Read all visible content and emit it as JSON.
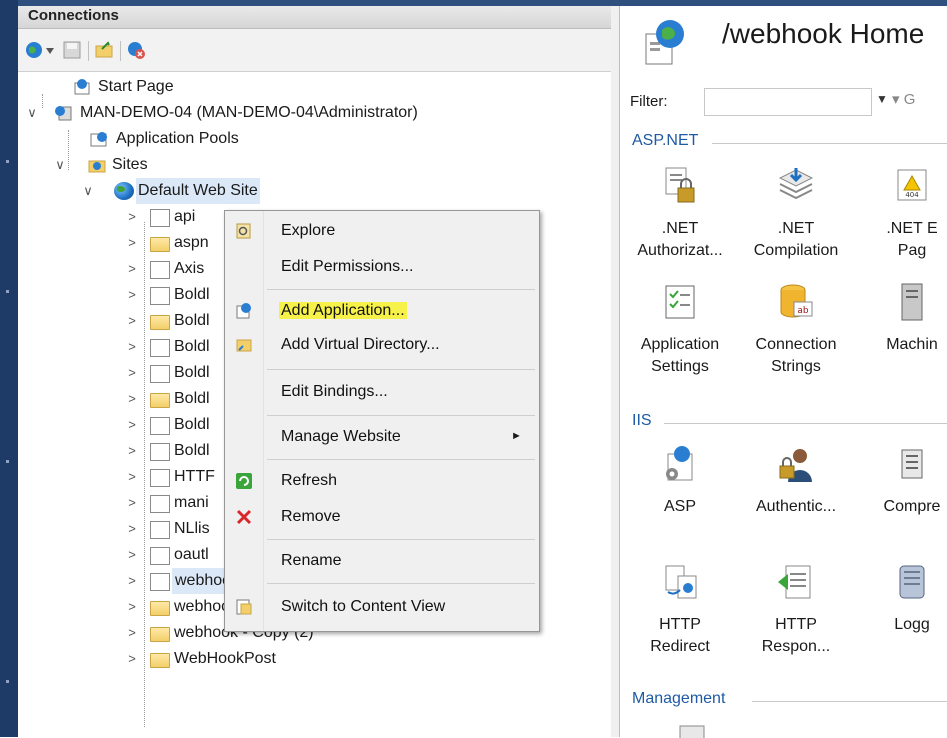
{
  "connections": {
    "title": "Connections",
    "tree": [
      {
        "label": "Start Page"
      },
      {
        "label": "MAN-DEMO-04 (MAN-DEMO-04\\Administrator)"
      },
      {
        "label": "Application Pools"
      },
      {
        "label": "Sites"
      },
      {
        "label": "Default Web Site"
      },
      {
        "label": "api"
      },
      {
        "label": "aspn"
      },
      {
        "label": "Axis"
      },
      {
        "label": "Boldl"
      },
      {
        "label": "Boldl"
      },
      {
        "label": "Boldl"
      },
      {
        "label": "Boldl"
      },
      {
        "label": "Boldl"
      },
      {
        "label": "Boldl"
      },
      {
        "label": "Boldl"
      },
      {
        "label": "HTTF"
      },
      {
        "label": "mani"
      },
      {
        "label": "NLlis"
      },
      {
        "label": "oautl"
      },
      {
        "label": "webhook"
      },
      {
        "label": "webhook - Copy"
      },
      {
        "label": "webhook - Copy (2)"
      },
      {
        "label": "WebHookPost"
      }
    ]
  },
  "context_menu": {
    "items": [
      {
        "label": "Explore"
      },
      {
        "label": "Edit Permissions..."
      },
      {
        "label": "Add Application..."
      },
      {
        "label": "Add Virtual Directory..."
      },
      {
        "label": "Edit Bindings..."
      },
      {
        "label": "Manage Website"
      },
      {
        "label": "Refresh"
      },
      {
        "label": "Remove"
      },
      {
        "label": "Rename"
      },
      {
        "label": "Switch to Content View"
      }
    ],
    "submenu_arrow": "►"
  },
  "features": {
    "title": "/webhook Home",
    "filter_label": "Filter:",
    "filter_value": "",
    "filter_go": "G",
    "groups": [
      {
        "name": "ASP.NET"
      },
      {
        "name": "IIS"
      },
      {
        "name": "Management"
      }
    ],
    "items": [
      {
        "l1": ".NET",
        "l2": "Authorizat..."
      },
      {
        "l1": ".NET",
        "l2": "Compilation"
      },
      {
        "l1": ".NET E",
        "l2": "Pag"
      },
      {
        "l1": "Application",
        "l2": "Settings"
      },
      {
        "l1": "Connection",
        "l2": "Strings"
      },
      {
        "l1": "Machin",
        "l2": ""
      },
      {
        "l1": "ASP",
        "l2": ""
      },
      {
        "l1": "Authentic...",
        "l2": ""
      },
      {
        "l1": "Compre",
        "l2": ""
      },
      {
        "l1": "HTTP",
        "l2": "Redirect"
      },
      {
        "l1": "HTTP",
        "l2": "Respon..."
      },
      {
        "l1": "Logg",
        "l2": ""
      }
    ]
  },
  "colors": {
    "highlight": "#f7f24a",
    "group_header": "#1f5aa5",
    "frame": "#1e3a66"
  }
}
